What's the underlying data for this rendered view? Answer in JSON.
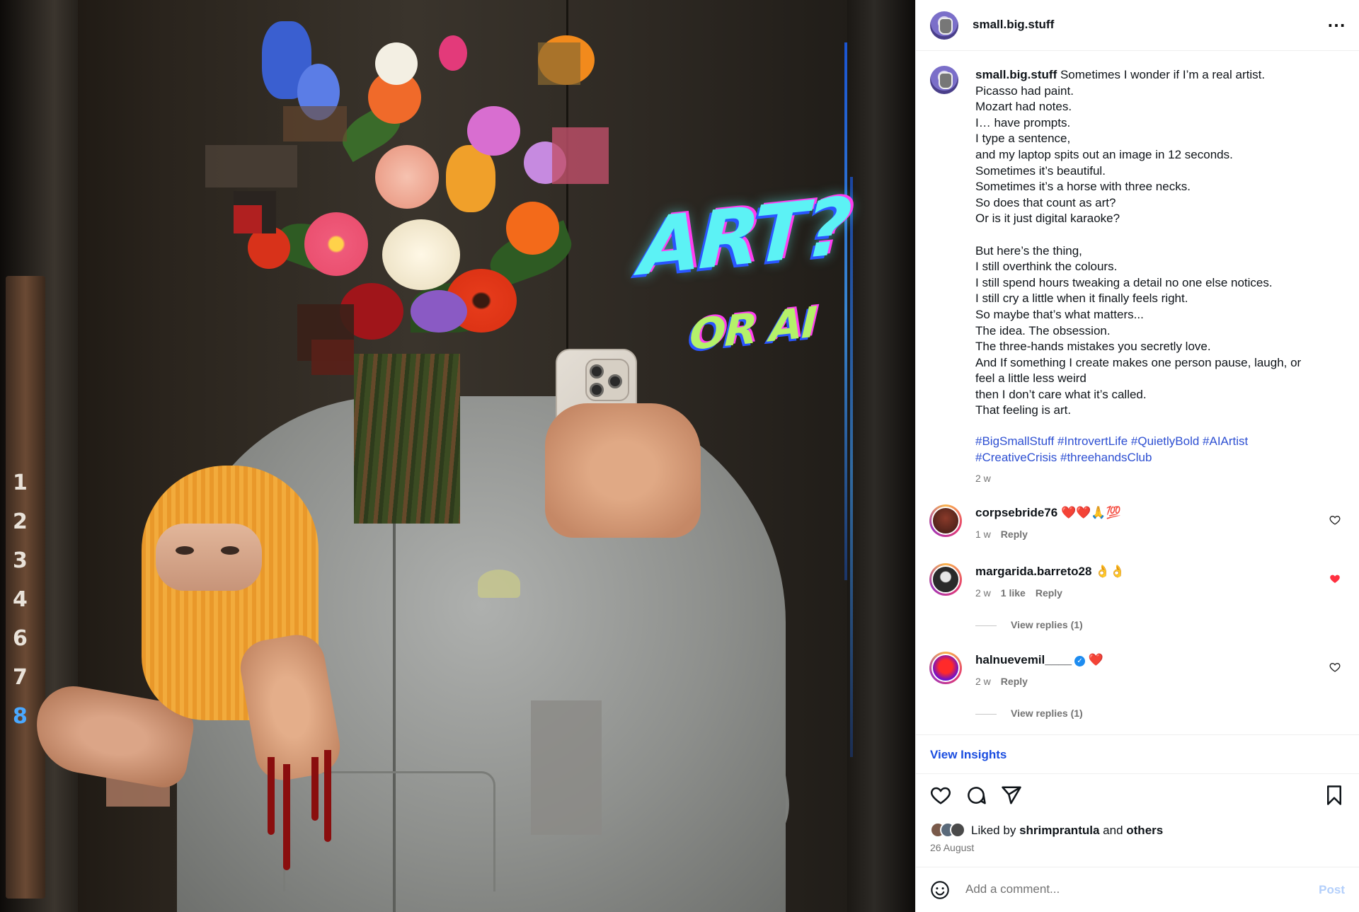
{
  "overlay": {
    "title": "ART?",
    "subtitle": "OR AI"
  },
  "floors": [
    "1",
    "2",
    "3",
    "4",
    "6",
    "7",
    "8"
  ],
  "post": {
    "username": "small.big.stuff",
    "more_icon": "more-horizontal-icon",
    "caption_lines": [
      "Sometimes I wonder if I’m a real artist.",
      "Picasso had paint.",
      "Mozart had notes.",
      "I… have prompts.",
      "I type a sentence,",
      "and my laptop spits out an image in 12 seconds.",
      "Sometimes it’s beautiful.",
      "Sometimes it’s a horse with three necks.",
      "So does that count as art?",
      "Or is it just digital karaoke?",
      "",
      "But here’s the thing,",
      "I still overthink the colours.",
      "I still spend hours tweaking a detail no one else notices.",
      "I still cry a little when it finally feels right.",
      "So maybe that’s what matters...",
      "The idea. The obsession.",
      "The three-hands mistakes you secretly love.",
      "And If something I create makes one person pause, laugh, or",
      "feel a little less weird",
      "then I don’t care what it’s called.",
      "That feeling is art."
    ],
    "hashtags": [
      "#BigSmallStuff",
      "#IntrovertLife",
      "#QuietlyBold",
      "#AIArtist",
      "#CreativeCrisis",
      "#threehandsClub"
    ],
    "caption_time": "2 w",
    "comments": [
      {
        "user": "corpsebride76",
        "text": "❤️❤️🙏💯",
        "time": "1 w",
        "likes": "",
        "reply": "Reply",
        "liked": false,
        "view_replies": ""
      },
      {
        "user": "margarida.barreto28",
        "text": "👌👌",
        "time": "2 w",
        "likes": "1 like",
        "reply": "Reply",
        "liked": true,
        "view_replies": "View replies (1)"
      },
      {
        "user": "halnuevemil____",
        "text": "❤️",
        "time": "2 w",
        "likes": "",
        "reply": "Reply",
        "liked": false,
        "verified": true,
        "view_replies": "View replies (1)"
      }
    ],
    "insights_label": "View Insights",
    "liked_by": {
      "prefix": "Liked by",
      "user": "shrimprantula",
      "and": "and",
      "others": "others"
    },
    "date": "26 August",
    "comment_placeholder": "Add a comment...",
    "post_label": "Post",
    "colors": {
      "link": "#2d4fd2",
      "insights": "#1a4de0",
      "like_red": "#ff3040",
      "post_disabled": "#b3cffb",
      "muted": "#737373"
    }
  }
}
